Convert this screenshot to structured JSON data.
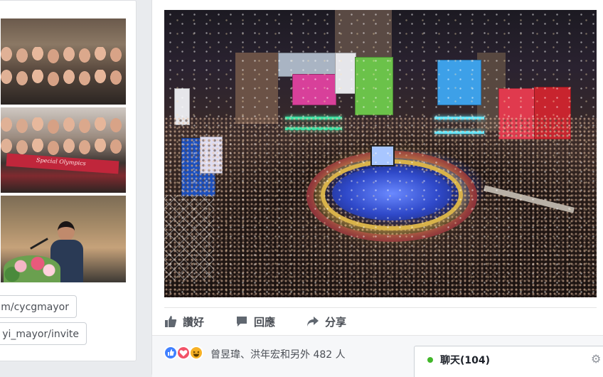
{
  "sidebar": {
    "links": [
      {
        "text": "m/cycgmayor"
      },
      {
        "text": "yi_mayor/invite"
      }
    ],
    "photos": [
      {
        "icon": "group-photo"
      },
      {
        "icon": "group-photo-banner",
        "banner_text": "Special Olympics"
      },
      {
        "icon": "speaker-photo"
      }
    ]
  },
  "post": {
    "image_icon": "new-year-concert-photo",
    "actions": {
      "like": "讚好",
      "comment": "回應",
      "share": "分享"
    },
    "reactions": {
      "icons": [
        "like-reaction",
        "love-reaction",
        "haha-reaction"
      ],
      "summary": "曾昱瑋、洪年宏和另外 482 人"
    }
  },
  "chat": {
    "label": "聊天(104)",
    "status_color": "#42b72a"
  },
  "colors": {
    "background": "#e9ebee",
    "card": "#ffffff",
    "link_text": "#4b4f56",
    "like_blue": "#4080ff",
    "love_red": "#f25268",
    "haha_yellow": "#f7b125"
  }
}
